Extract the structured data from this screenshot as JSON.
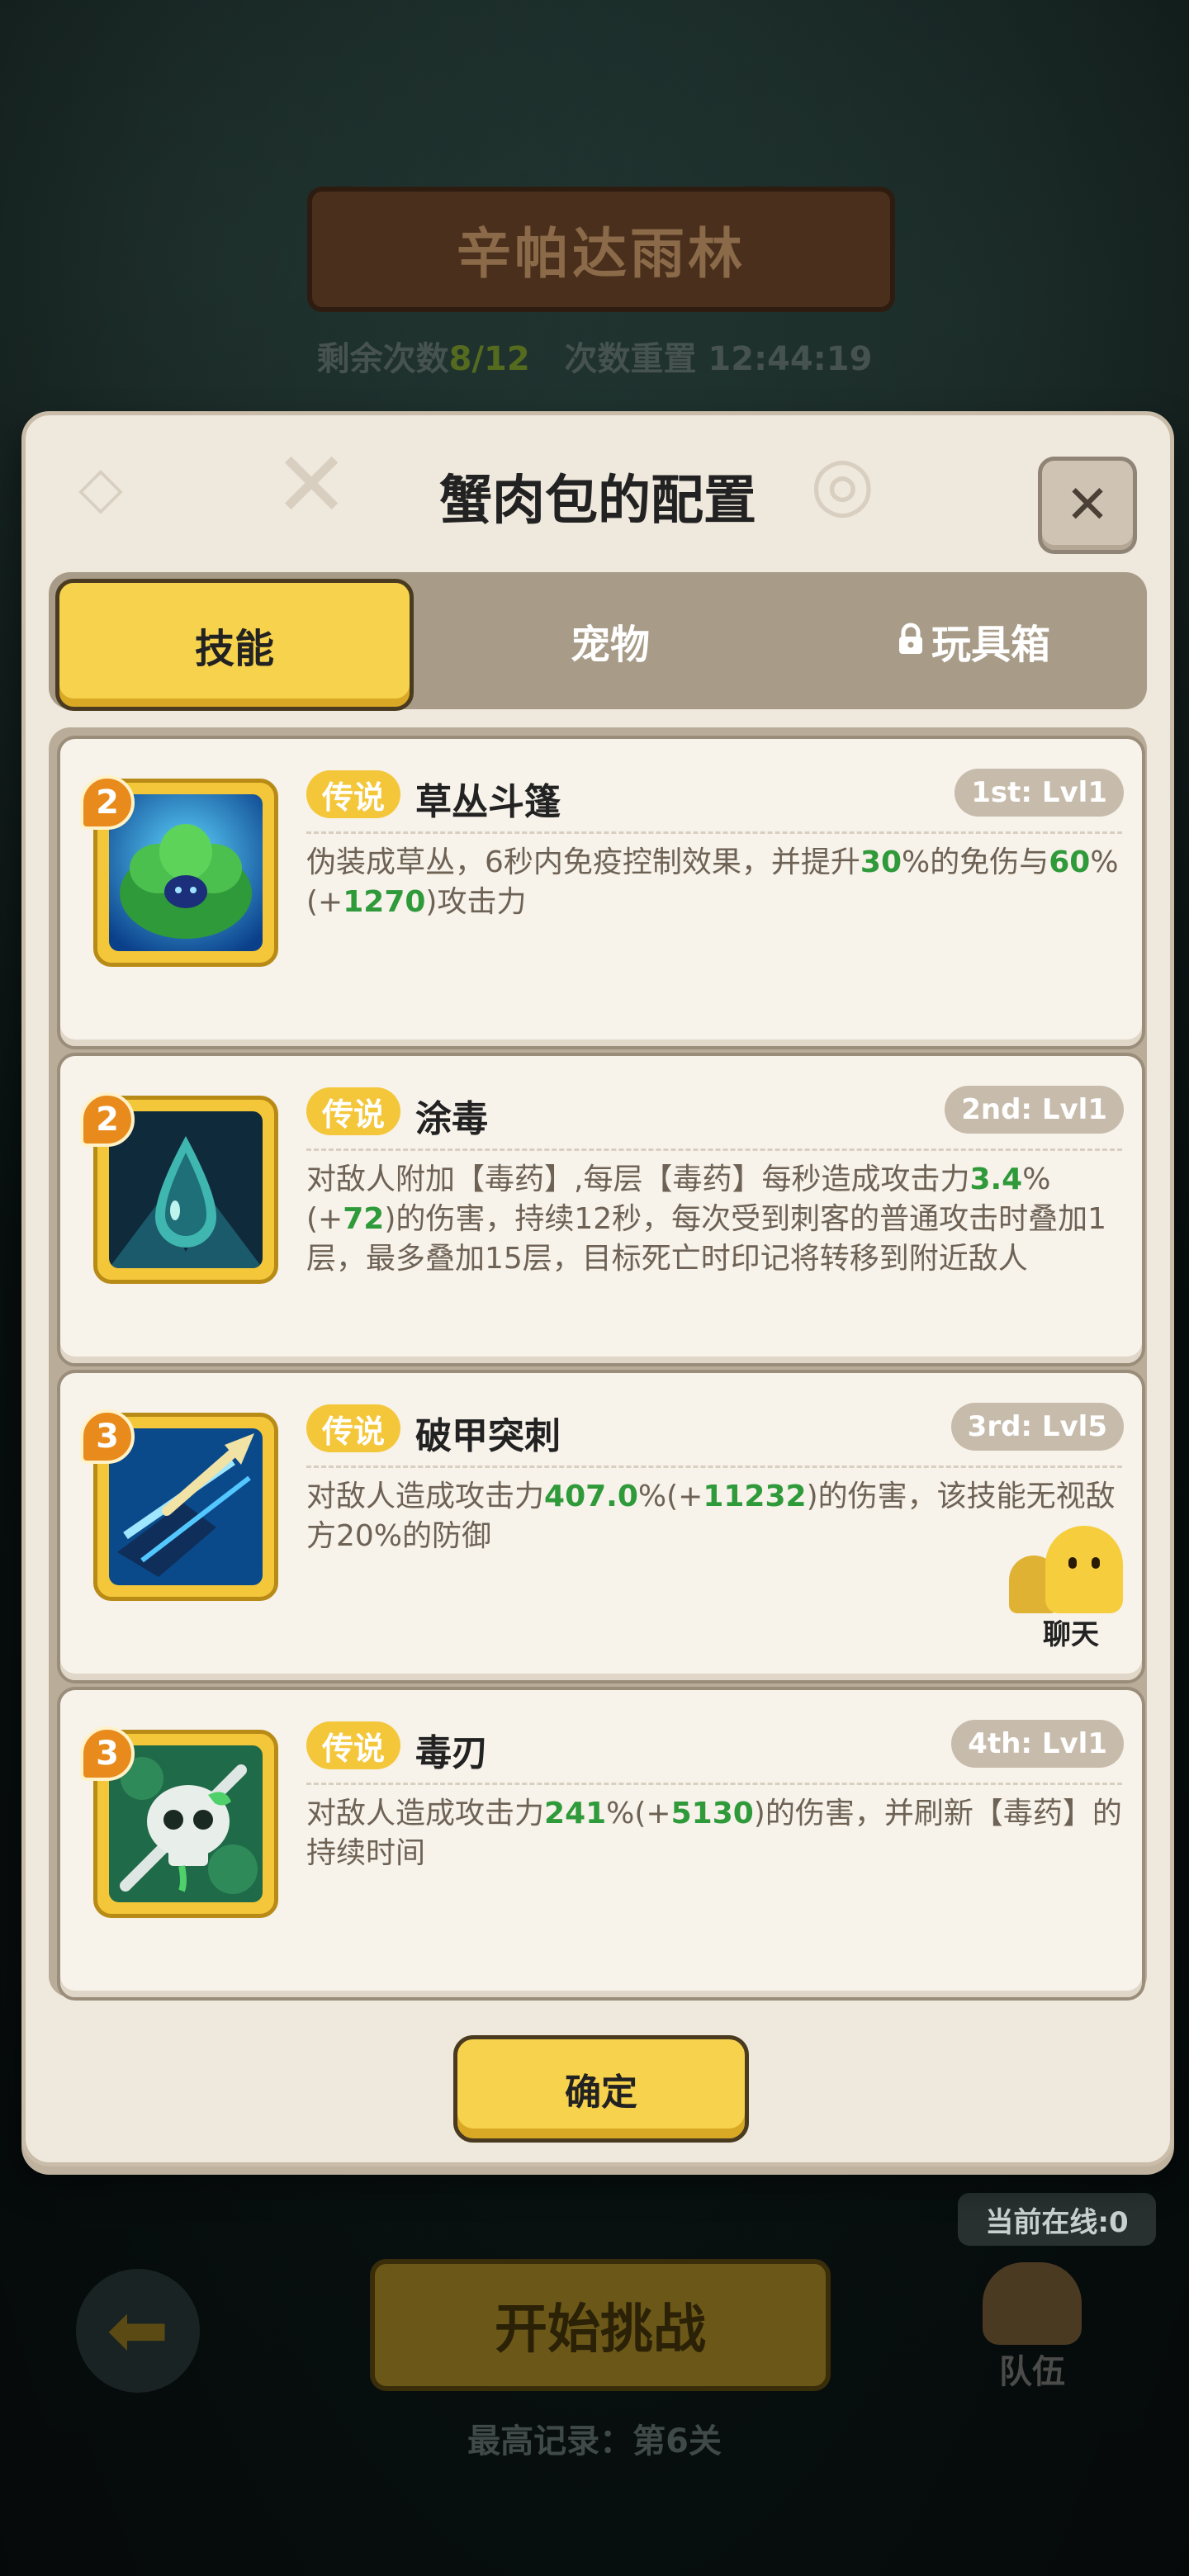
{
  "background": {
    "stage_title": "辛帕达雨林",
    "remaining_label": "剩余次数",
    "remaining_value": "8/12",
    "reset_label": "次数重置",
    "reset_time": "12:44:19",
    "start_button": "开始挑战",
    "record": "最高记录：第6关",
    "online": "当前在线:0",
    "team": "队伍"
  },
  "dialog": {
    "title": "蟹肉包的配置",
    "close_icon": "close-icon",
    "tabs": [
      {
        "label": "技能",
        "active": true
      },
      {
        "label": "宠物",
        "active": false
      },
      {
        "label": "玩具箱",
        "active": false,
        "locked": true
      }
    ],
    "confirm_label": "确定"
  },
  "skills": [
    {
      "level": "2",
      "rarity": "传说",
      "name": "草丛斗篷",
      "slot": "1st: Lvl1",
      "icon": "bush-cloak-icon",
      "desc": [
        "伪装成草丛，6秒内免疫控制效果，并提升",
        "30",
        "%的免伤与",
        "60",
        "%(+",
        "1270",
        ")攻击力"
      ]
    },
    {
      "level": "2",
      "rarity": "传说",
      "name": "涂毒",
      "slot": "2nd: Lvl1",
      "icon": "poison-drop-icon",
      "desc": [
        "对敌人附加【毒药】,每层【毒药】每秒造成攻击力",
        "3.4",
        "%(+",
        "72",
        ")的伤害，持续12秒，每次受到刺客的普通攻击时叠加1层，最多叠加15层，目标死亡时印记将转移到附近敌人"
      ]
    },
    {
      "level": "3",
      "rarity": "传说",
      "name": "破甲突刺",
      "slot": "3rd: Lvl5",
      "icon": "armor-pierce-icon",
      "desc": [
        "对敌人造成攻击力",
        "407.0",
        "%(+",
        "11232",
        ")的伤害，该技能无视敌方20%的防御"
      ]
    },
    {
      "level": "3",
      "rarity": "传说",
      "name": "毒刃",
      "slot": "4th: Lvl1",
      "icon": "poison-skull-icon",
      "desc": [
        "对敌人造成攻击力",
        "241",
        "%(+",
        "5130",
        ")的伤害，并刷新【毒药】的持续时间"
      ]
    }
  ],
  "chat": {
    "label": "聊天"
  },
  "colors": {
    "accent_yellow": "#f6d24d",
    "green_value": "#2f9a3a",
    "panel": "#efe8dc"
  }
}
